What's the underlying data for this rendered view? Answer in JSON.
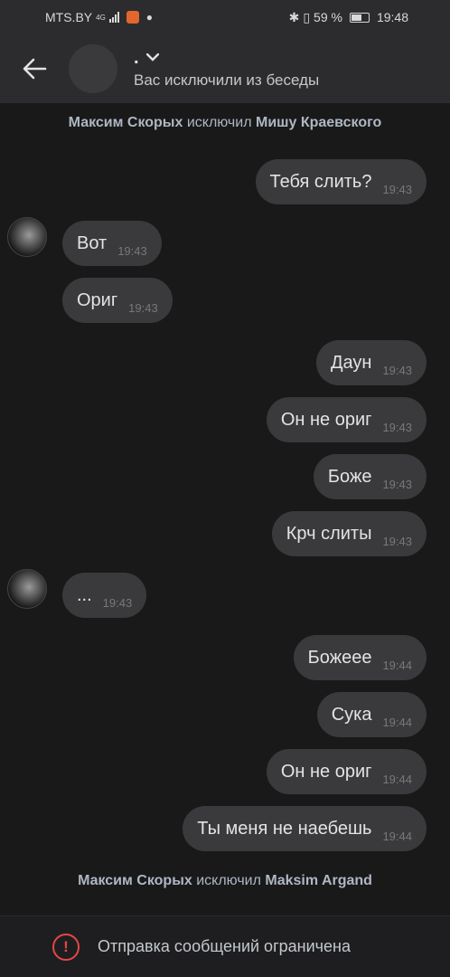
{
  "status_bar": {
    "carrier": "MTS.BY",
    "network": "4G",
    "battery": "59 %",
    "time": "19:48"
  },
  "header": {
    "back_icon": "arrow-left-icon",
    "title": ".",
    "subtitle": "Вас исключили из беседы"
  },
  "system_messages": [
    {
      "actor": "Максим Скорых",
      "action": "исключил",
      "target": "Мишу Краевского"
    },
    {
      "actor": "Максим Скорых",
      "action": "исключил",
      "target": "Maksim Argand"
    }
  ],
  "messages": [
    {
      "dir": "out",
      "text": "Тебя слить?",
      "time": "19:43"
    },
    {
      "dir": "in",
      "text": "Вот",
      "time": "19:43"
    },
    {
      "dir": "in",
      "text": "Ориг",
      "time": "19:43"
    },
    {
      "dir": "out",
      "text": "Даун",
      "time": "19:43"
    },
    {
      "dir": "out",
      "text": "Он не ориг",
      "time": "19:43"
    },
    {
      "dir": "out",
      "text": "Боже",
      "time": "19:43"
    },
    {
      "dir": "out",
      "text": "Крч слиты",
      "time": "19:43"
    },
    {
      "dir": "in",
      "text": "...",
      "time": "19:43"
    },
    {
      "dir": "out",
      "text": "Божеее",
      "time": "19:44"
    },
    {
      "dir": "out",
      "text": "Сука",
      "time": "19:44"
    },
    {
      "dir": "out",
      "text": "Он не ориг",
      "time": "19:44"
    },
    {
      "dir": "out",
      "text": "Ты меня не наебешь",
      "time": "19:44"
    }
  ],
  "footer": {
    "icon": "warning-icon",
    "text": "Отправка сообщений ограничена"
  },
  "colors": {
    "background": "#19191a",
    "header": "#2c2c2e",
    "bubble": "#3a3a3c",
    "warning": "#e64646"
  }
}
